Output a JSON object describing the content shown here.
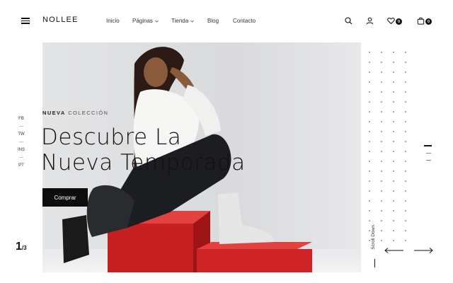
{
  "brand": {
    "logo": "NOLLEE"
  },
  "nav": {
    "items": [
      {
        "label": "Inicio",
        "has_dropdown": false
      },
      {
        "label": "Páginas",
        "has_dropdown": true
      },
      {
        "label": "Tienda",
        "has_dropdown": true
      },
      {
        "label": "Blog",
        "has_dropdown": false
      },
      {
        "label": "Contacto",
        "has_dropdown": false
      }
    ]
  },
  "header_actions": {
    "search_icon": "search-icon",
    "account_icon": "user-icon",
    "wishlist_icon": "heart-icon",
    "wishlist_count": "0",
    "cart_icon": "bag-icon",
    "cart_count": "0"
  },
  "hero": {
    "eyebrow_bold": "NUEVA",
    "eyebrow_rest": "COLECCIÓN",
    "headline_line1": "Descubre La",
    "headline_line2": "Nueva Temporada",
    "cta_label": "Comprar"
  },
  "social": {
    "items": [
      "FB",
      "TW",
      "INS",
      "PT"
    ],
    "separator": "—"
  },
  "pager": {
    "current": "1",
    "total": "/3"
  },
  "scroll_label": "Scroll Down",
  "colors": {
    "accent": "#111111",
    "hero_bg": "#dfe0e2",
    "box_red": "#d42525"
  }
}
